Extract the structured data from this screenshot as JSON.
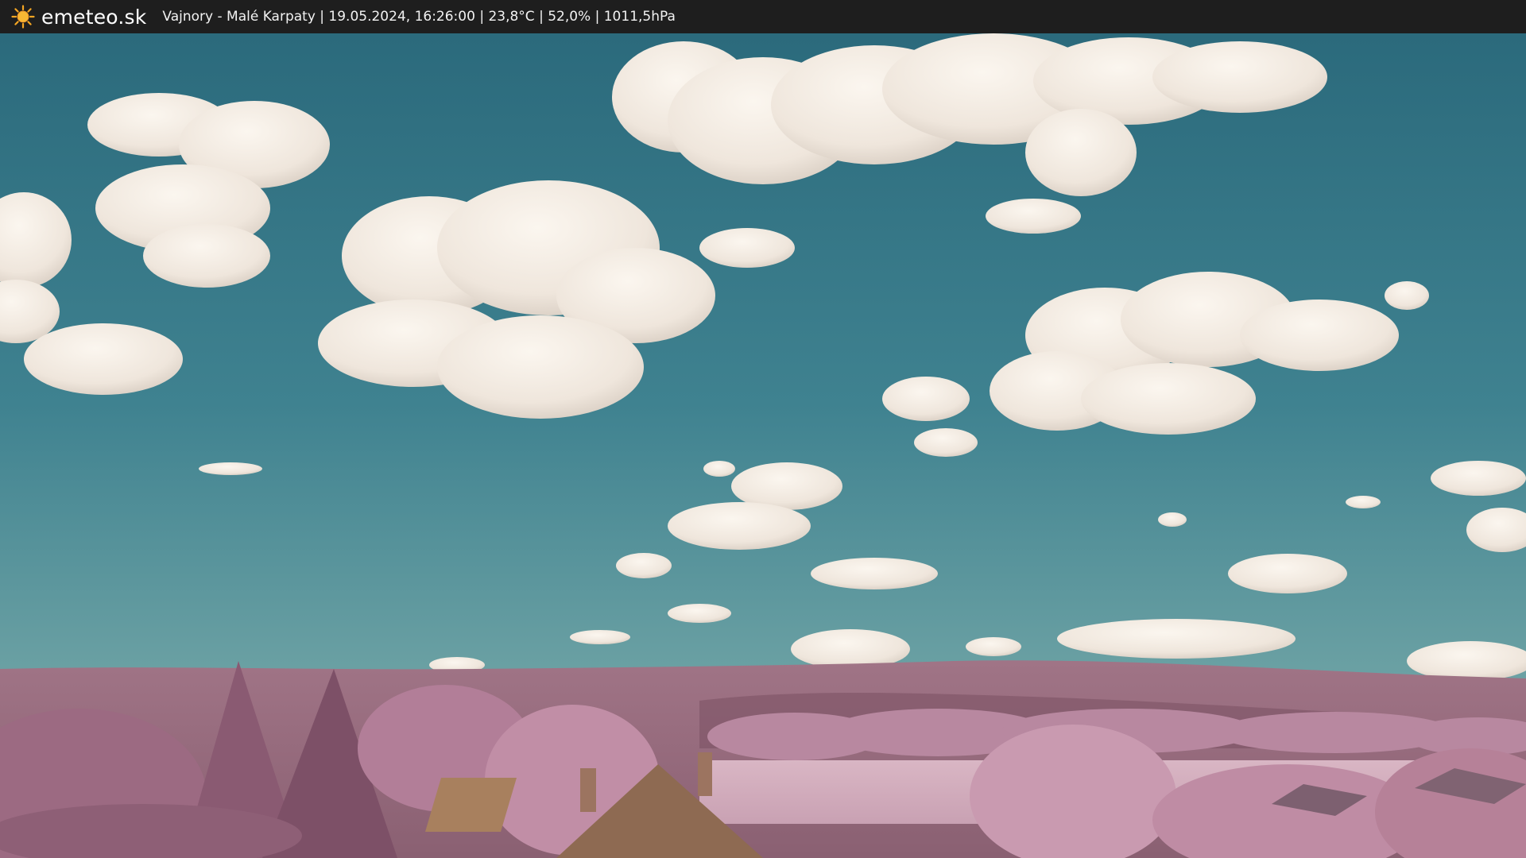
{
  "header": {
    "brand": "emeteo.sk",
    "caption": "Vajnory - Malé Karpaty | 19.05.2024, 16:26:00 | 23,8°C | 52,0% | 1011,5hPa",
    "logo_icon": "sun-icon"
  },
  "colors": {
    "topbar": "#1e1e1e",
    "sky_top": "#2d6f7e",
    "sky_bottom": "#6fa4a6",
    "cloud": "#f3ece4",
    "foliage": "#b88aa0",
    "hills": "#9a6f80",
    "logo_sun": "#f5a623"
  }
}
